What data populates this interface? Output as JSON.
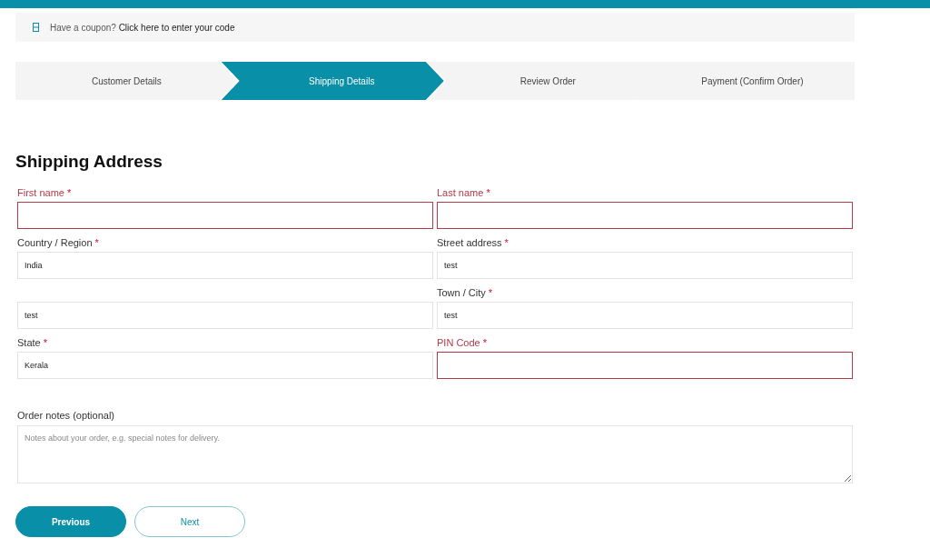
{
  "coupon": {
    "text": "Have a coupon?",
    "link": "Click here to enter your code"
  },
  "steps": [
    {
      "label": "Customer Details",
      "selected": false
    },
    {
      "label": "Shipping Details",
      "selected": true
    },
    {
      "label": "Review Order",
      "selected": false
    },
    {
      "label": "Payment (Confirm Order)",
      "selected": false
    }
  ],
  "heading": "Shipping Address",
  "fields": [
    {
      "label": "First name",
      "asterisk": "*",
      "invalid": true
    },
    {
      "label": "Last name",
      "asterisk": "*",
      "invalid": true
    },
    {
      "label": "Country / Region",
      "asterisk": "*",
      "invalid": false,
      "value": "India"
    },
    {
      "label": "Street address",
      "asterisk": "*",
      "invalid": false,
      "value": "test"
    },
    {
      "invalid": false,
      "value": "test"
    },
    {
      "label": "Town / City",
      "asterisk": "*",
      "invalid": false,
      "value": "test"
    },
    {
      "label": "State",
      "asterisk": "*",
      "invalid": false,
      "value": "Kerala"
    },
    {
      "label": "PIN Code",
      "asterisk": "*",
      "invalid": true
    }
  ],
  "notes": {
    "label": "Order notes (optional)",
    "placeholder": "Notes about your order, e.g. special notes for delivery."
  },
  "buttons": [
    {
      "label": "Previous",
      "kind": "primary"
    },
    {
      "label": "Next",
      "kind": "secondary"
    }
  ]
}
